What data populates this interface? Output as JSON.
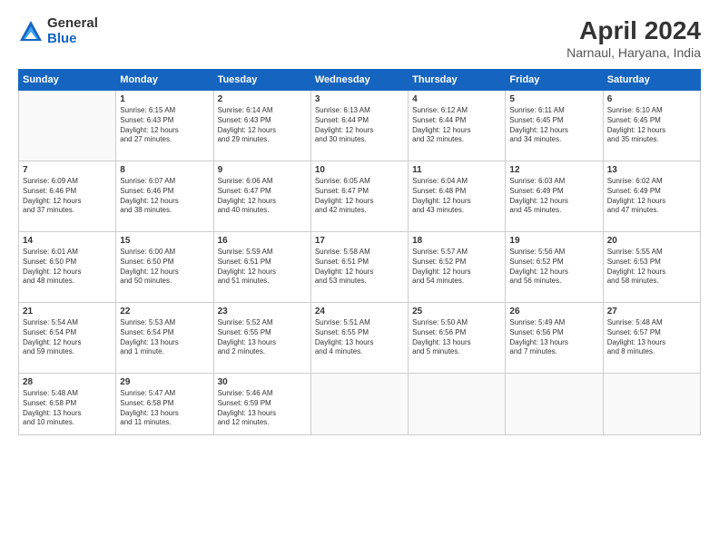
{
  "logo": {
    "general": "General",
    "blue": "Blue"
  },
  "header": {
    "month_year": "April 2024",
    "location": "Narnaul, Haryana, India"
  },
  "weekdays": [
    "Sunday",
    "Monday",
    "Tuesday",
    "Wednesday",
    "Thursday",
    "Friday",
    "Saturday"
  ],
  "weeks": [
    [
      {
        "day": "",
        "content": ""
      },
      {
        "day": "1",
        "content": "Sunrise: 6:15 AM\nSunset: 6:43 PM\nDaylight: 12 hours\nand 27 minutes."
      },
      {
        "day": "2",
        "content": "Sunrise: 6:14 AM\nSunset: 6:43 PM\nDaylight: 12 hours\nand 29 minutes."
      },
      {
        "day": "3",
        "content": "Sunrise: 6:13 AM\nSunset: 6:44 PM\nDaylight: 12 hours\nand 30 minutes."
      },
      {
        "day": "4",
        "content": "Sunrise: 6:12 AM\nSunset: 6:44 PM\nDaylight: 12 hours\nand 32 minutes."
      },
      {
        "day": "5",
        "content": "Sunrise: 6:11 AM\nSunset: 6:45 PM\nDaylight: 12 hours\nand 34 minutes."
      },
      {
        "day": "6",
        "content": "Sunrise: 6:10 AM\nSunset: 6:45 PM\nDaylight: 12 hours\nand 35 minutes."
      }
    ],
    [
      {
        "day": "7",
        "content": "Sunrise: 6:09 AM\nSunset: 6:46 PM\nDaylight: 12 hours\nand 37 minutes."
      },
      {
        "day": "8",
        "content": "Sunrise: 6:07 AM\nSunset: 6:46 PM\nDaylight: 12 hours\nand 38 minutes."
      },
      {
        "day": "9",
        "content": "Sunrise: 6:06 AM\nSunset: 6:47 PM\nDaylight: 12 hours\nand 40 minutes."
      },
      {
        "day": "10",
        "content": "Sunrise: 6:05 AM\nSunset: 6:47 PM\nDaylight: 12 hours\nand 42 minutes."
      },
      {
        "day": "11",
        "content": "Sunrise: 6:04 AM\nSunset: 6:48 PM\nDaylight: 12 hours\nand 43 minutes."
      },
      {
        "day": "12",
        "content": "Sunrise: 6:03 AM\nSunset: 6:49 PM\nDaylight: 12 hours\nand 45 minutes."
      },
      {
        "day": "13",
        "content": "Sunrise: 6:02 AM\nSunset: 6:49 PM\nDaylight: 12 hours\nand 47 minutes."
      }
    ],
    [
      {
        "day": "14",
        "content": "Sunrise: 6:01 AM\nSunset: 6:50 PM\nDaylight: 12 hours\nand 48 minutes."
      },
      {
        "day": "15",
        "content": "Sunrise: 6:00 AM\nSunset: 6:50 PM\nDaylight: 12 hours\nand 50 minutes."
      },
      {
        "day": "16",
        "content": "Sunrise: 5:59 AM\nSunset: 6:51 PM\nDaylight: 12 hours\nand 51 minutes."
      },
      {
        "day": "17",
        "content": "Sunrise: 5:58 AM\nSunset: 6:51 PM\nDaylight: 12 hours\nand 53 minutes."
      },
      {
        "day": "18",
        "content": "Sunrise: 5:57 AM\nSunset: 6:52 PM\nDaylight: 12 hours\nand 54 minutes."
      },
      {
        "day": "19",
        "content": "Sunrise: 5:56 AM\nSunset: 6:52 PM\nDaylight: 12 hours\nand 56 minutes."
      },
      {
        "day": "20",
        "content": "Sunrise: 5:55 AM\nSunset: 6:53 PM\nDaylight: 12 hours\nand 58 minutes."
      }
    ],
    [
      {
        "day": "21",
        "content": "Sunrise: 5:54 AM\nSunset: 6:54 PM\nDaylight: 12 hours\nand 59 minutes."
      },
      {
        "day": "22",
        "content": "Sunrise: 5:53 AM\nSunset: 6:54 PM\nDaylight: 13 hours\nand 1 minute."
      },
      {
        "day": "23",
        "content": "Sunrise: 5:52 AM\nSunset: 6:55 PM\nDaylight: 13 hours\nand 2 minutes."
      },
      {
        "day": "24",
        "content": "Sunrise: 5:51 AM\nSunset: 6:55 PM\nDaylight: 13 hours\nand 4 minutes."
      },
      {
        "day": "25",
        "content": "Sunrise: 5:50 AM\nSunset: 6:56 PM\nDaylight: 13 hours\nand 5 minutes."
      },
      {
        "day": "26",
        "content": "Sunrise: 5:49 AM\nSunset: 6:56 PM\nDaylight: 13 hours\nand 7 minutes."
      },
      {
        "day": "27",
        "content": "Sunrise: 5:48 AM\nSunset: 6:57 PM\nDaylight: 13 hours\nand 8 minutes."
      }
    ],
    [
      {
        "day": "28",
        "content": "Sunrise: 5:48 AM\nSunset: 6:58 PM\nDaylight: 13 hours\nand 10 minutes."
      },
      {
        "day": "29",
        "content": "Sunrise: 5:47 AM\nSunset: 6:58 PM\nDaylight: 13 hours\nand 11 minutes."
      },
      {
        "day": "30",
        "content": "Sunrise: 5:46 AM\nSunset: 6:59 PM\nDaylight: 13 hours\nand 12 minutes."
      },
      {
        "day": "",
        "content": ""
      },
      {
        "day": "",
        "content": ""
      },
      {
        "day": "",
        "content": ""
      },
      {
        "day": "",
        "content": ""
      }
    ]
  ]
}
